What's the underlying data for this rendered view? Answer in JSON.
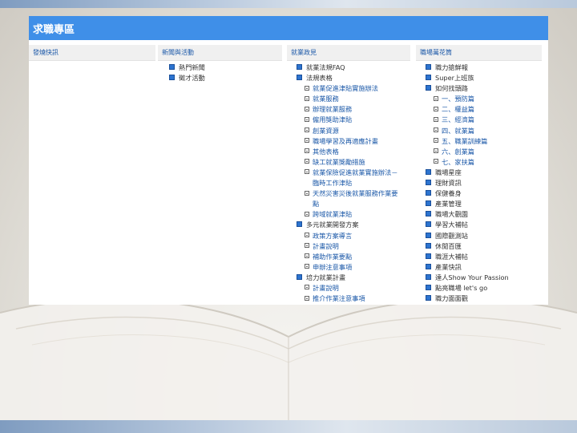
{
  "panel": {
    "title": "求職專區"
  },
  "columns": [
    {
      "heading": "發燒快訊",
      "items": []
    },
    {
      "heading": "新聞與活動",
      "items": [
        {
          "label": "熱門新聞",
          "level": 1
        },
        {
          "label": "徵才活動",
          "level": 1
        }
      ]
    },
    {
      "heading": "就業政見",
      "items": [
        {
          "label": "就業法規FAQ",
          "level": 1
        },
        {
          "label": "法規表格",
          "level": 1
        },
        {
          "label": "就業促進津貼實施辦法",
          "level": 2
        },
        {
          "label": "就業服務",
          "level": 2
        },
        {
          "label": "辦理就業服務",
          "level": 2
        },
        {
          "label": "僱用獎助津貼",
          "level": 2
        },
        {
          "label": "創業資源",
          "level": 2
        },
        {
          "label": "職場學習及再適應計畫",
          "level": 2
        },
        {
          "label": "其他表格",
          "level": 2
        },
        {
          "label": "缺工就業獎勵措施",
          "level": 2
        },
        {
          "label": "就業保險促進就業實施辦法－",
          "level": 2
        },
        {
          "label": "臨時工作津貼",
          "level": 3
        },
        {
          "label": "天然災害災後就業服務作業要",
          "level": 2
        },
        {
          "label": "點",
          "level": 3
        },
        {
          "label": "跨域就業津貼",
          "level": 2
        },
        {
          "label": "多元就業開發方案",
          "level": 1
        },
        {
          "label": "政策方案導言",
          "level": 2
        },
        {
          "label": "計畫說明",
          "level": 2
        },
        {
          "label": "補助作業要點",
          "level": 2
        },
        {
          "label": "申辦注意事項",
          "level": 2
        },
        {
          "label": "培力就業計畫",
          "level": 1
        },
        {
          "label": "計畫說明",
          "level": 2
        },
        {
          "label": "推介作業注意事項",
          "level": 2
        }
      ]
    },
    {
      "heading": "職場萬花筒",
      "items": [
        {
          "label": "職力搶鮮報",
          "level": 1
        },
        {
          "label": "Super上班族",
          "level": 1
        },
        {
          "label": "如何找頭路",
          "level": 1
        },
        {
          "label": "一、預防篇",
          "level": 2
        },
        {
          "label": "二、權益篇",
          "level": 2
        },
        {
          "label": "三、經濟篇",
          "level": 2
        },
        {
          "label": "四、就業篇",
          "level": 2
        },
        {
          "label": "五、職業訓練篇",
          "level": 2
        },
        {
          "label": "六、創業篇",
          "level": 2
        },
        {
          "label": "七、家扶篇",
          "level": 2
        },
        {
          "label": "職場星座",
          "level": 1
        },
        {
          "label": "理財資訊",
          "level": 1
        },
        {
          "label": "保健養身",
          "level": 1
        },
        {
          "label": "產業管理",
          "level": 1
        },
        {
          "label": "職場大觀園",
          "level": 1
        },
        {
          "label": "學習大補帖",
          "level": 1
        },
        {
          "label": "國際觀測站",
          "level": 1
        },
        {
          "label": "休閒百匯",
          "level": 1
        },
        {
          "label": "職涯大補帖",
          "level": 1
        },
        {
          "label": "產業快訊",
          "level": 1
        },
        {
          "label": "達人Show Your Passion",
          "level": 1
        },
        {
          "label": "點亮職場 let's go",
          "level": 1
        },
        {
          "label": "職力面面觀",
          "level": 1
        }
      ]
    }
  ],
  "colors": {
    "header_bg": "#3f8fe8",
    "link": "#1b58a8",
    "text": "#333333"
  }
}
